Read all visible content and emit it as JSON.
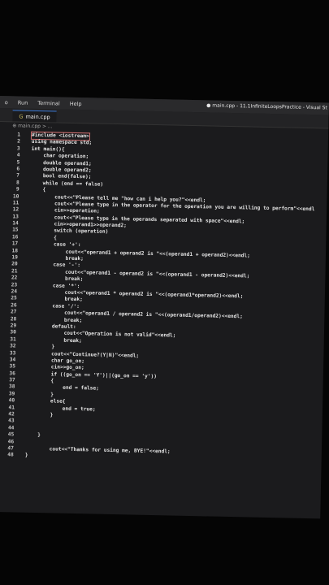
{
  "menu": {
    "items": [
      "o",
      "Run",
      "Terminal",
      "Help"
    ],
    "window_title": "● main.cpp - 11.1InfiniteLoopsPractice - Visual St"
  },
  "tab": {
    "label": "main.cpp"
  },
  "breadcrumb": "⊕ main.cpp > ...",
  "code_lines": [
    {
      "n": "1",
      "t": "#include <iostream>"
    },
    {
      "n": "2",
      "t": "using namespace std;"
    },
    {
      "n": "3",
      "t": "int main(){"
    },
    {
      "n": "4",
      "t": "    char operation;"
    },
    {
      "n": "5",
      "t": "    double operand1;"
    },
    {
      "n": "6",
      "t": "    double operand2;"
    },
    {
      "n": "7",
      "t": "    bool end(false);"
    },
    {
      "n": "8",
      "t": "    while (end == false)"
    },
    {
      "n": "9",
      "t": "    {"
    },
    {
      "n": "10",
      "t": "        cout<<\"Please tell me \"how can i help you?\"<<endl;"
    },
    {
      "n": "11",
      "t": "        cout<<\"Please type in the operator for the operation you are willing to perform\"<<endl"
    },
    {
      "n": "12",
      "t": "        cin>>operation;"
    },
    {
      "n": "13",
      "t": "        cout<<\"Please type in the operands separated with space\"<<endl;"
    },
    {
      "n": "14",
      "t": "        cin>>operand1>>operand2;"
    },
    {
      "n": "15",
      "t": "        switch (operation)"
    },
    {
      "n": "16",
      "t": "        {"
    },
    {
      "n": "17",
      "t": "        case '+':"
    },
    {
      "n": "18",
      "t": "            cout<<\"operand1 + operand2 is \"<<(operand1 + operand2)<<endl;"
    },
    {
      "n": "19",
      "t": "            break;"
    },
    {
      "n": "20",
      "t": "        case '-':"
    },
    {
      "n": "21",
      "t": "            cout<<\"operand1 - operand2 is \"<<(operand1 - operand2)<<endl;"
    },
    {
      "n": "22",
      "t": "            break;"
    },
    {
      "n": "23",
      "t": "        case '*':"
    },
    {
      "n": "24",
      "t": "            cout<<\"operand1 * operand2 is \"<<(operand1*operand2)<<endl;"
    },
    {
      "n": "25",
      "t": "            break;"
    },
    {
      "n": "26",
      "t": "        case '/':"
    },
    {
      "n": "27",
      "t": "            cout<<\"operand1 / operand2 is \"<<(operand1/operand2)<<endl;"
    },
    {
      "n": "28",
      "t": "            break;"
    },
    {
      "n": "29",
      "t": "        default:"
    },
    {
      "n": "30",
      "t": "            cout<<\"Operation is not valid\"<<endl;"
    },
    {
      "n": "31",
      "t": "            break;"
    },
    {
      "n": "32",
      "t": "        }"
    },
    {
      "n": "33",
      "t": "        cout<<\"Continue?(Y|N)\"<<endl;"
    },
    {
      "n": "34",
      "t": "        char go_on;"
    },
    {
      "n": "35",
      "t": "        cin>>go_on;"
    },
    {
      "n": "36",
      "t": "        if ((go_on == 'Y')||(go_on == 'y'))"
    },
    {
      "n": "37",
      "t": "        {"
    },
    {
      "n": "38",
      "t": "            end = false;"
    },
    {
      "n": "39",
      "t": "        }"
    },
    {
      "n": "40",
      "t": "        else{"
    },
    {
      "n": "41",
      "t": "            end = true;"
    },
    {
      "n": "42",
      "t": "        }"
    },
    {
      "n": "43",
      "t": ""
    },
    {
      "n": "44",
      "t": ""
    },
    {
      "n": "45",
      "t": "    }"
    },
    {
      "n": "46",
      "t": ""
    },
    {
      "n": "47",
      "t": "        cout<<\"Thanks for using me, BYE!\"<<endl;"
    },
    {
      "n": "48",
      "t": "}"
    }
  ]
}
